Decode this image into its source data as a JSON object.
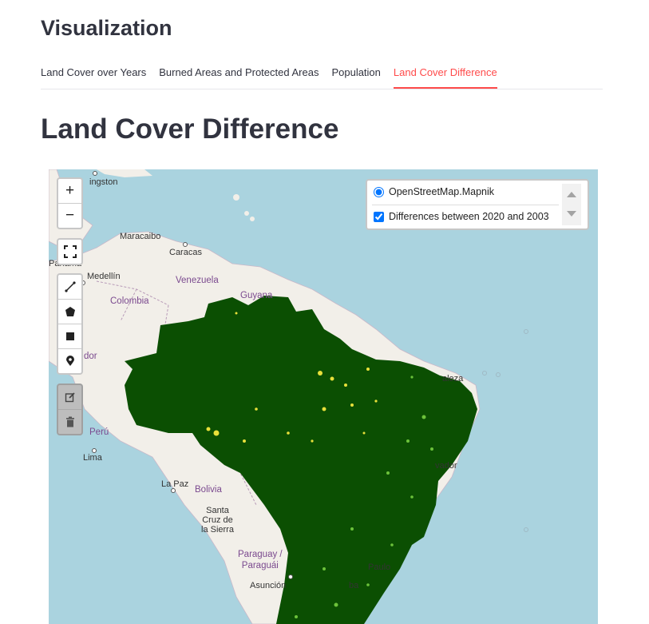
{
  "section_title": "Visualization",
  "tabs": [
    {
      "label": "Land Cover over Years",
      "active": false
    },
    {
      "label": "Burned Areas and Protected Areas",
      "active": false
    },
    {
      "label": "Population",
      "active": false
    },
    {
      "label": "Land Cover Difference",
      "active": true
    }
  ],
  "heading": "Land Cover Difference",
  "map": {
    "zoom_controls": {
      "zoom_in": "+",
      "zoom_out": "−"
    },
    "layer_control": {
      "base_layer": "OpenStreetMap.Mapnik",
      "base_layer_selected": true,
      "overlay": "Differences between 2020 and 2003",
      "overlay_checked": true
    },
    "labels": {
      "kingston": "ingston",
      "maracaibo": "Maracaibo",
      "caracas": "Caracas",
      "panama": "Panamá",
      "medellin": "Medellín",
      "venezuela": "Venezuela",
      "guyana": "Guyana",
      "colombia": "Colombia",
      "ecuador": "dor",
      "fortaleza": "aleza",
      "peru": "Perú",
      "lima": "Lima",
      "salvador": "vador",
      "la_paz": "La Paz",
      "bolivia": "Bolivia",
      "santa_cruz": "Santa\nCruz de\nla Sierra",
      "paraguay": "Paraguay /\nParaguái",
      "asuncion": "Asunción",
      "sao_paulo": "Paulo",
      "curitiba": "ba"
    },
    "colors": {
      "water": "#aad3df",
      "land": "#f2efe9",
      "overlay": "#0b4f02",
      "change_yellow": "#e8e03a",
      "change_light_green": "#6cc23a"
    }
  }
}
